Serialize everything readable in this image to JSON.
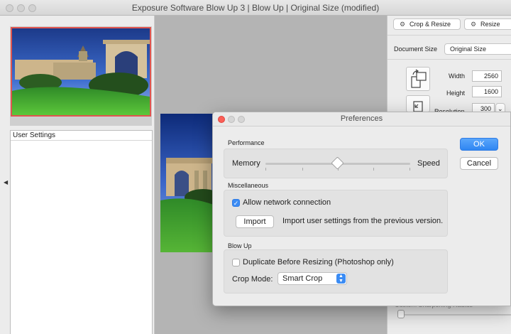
{
  "window": {
    "title": "Exposure Software Blow Up 3 | Blow Up | Original Size (modified)"
  },
  "left_panel": {
    "user_settings_header": "User Settings"
  },
  "right_panel": {
    "tabs": [
      "Crop & Resize",
      "Resize"
    ],
    "document_size_label": "Document Size",
    "document_size_value": "Original Size",
    "width_label": "Width",
    "width_value": "2560",
    "height_label": "Height",
    "height_value": "1600",
    "resolution_label": "Resolution",
    "resolution_value": "300",
    "sharpening_label": "Custom Sharpening Radius"
  },
  "dialog": {
    "title": "Preferences",
    "ok_label": "OK",
    "cancel_label": "Cancel",
    "performance": {
      "section_label": "Performance",
      "memory_label": "Memory",
      "speed_label": "Speed",
      "slider_value_fraction": 0.5
    },
    "miscellaneous": {
      "section_label": "Miscellaneous",
      "allow_network_label": "Allow network connection",
      "allow_network_checked": true,
      "import_button": "Import",
      "import_description": "Import user settings from the previous version."
    },
    "blow_up": {
      "section_label": "Blow Up",
      "duplicate_label": "Duplicate Before Resizing (Photoshop only)",
      "duplicate_checked": false,
      "crop_mode_label": "Crop Mode:",
      "crop_mode_value": "Smart Crop"
    }
  },
  "colors": {
    "accent": "#3b8cf4",
    "selection_border": "#e0554f"
  },
  "icons": [
    "swap-orientation-icon",
    "crop-icon",
    "gear-icon",
    "chevron-updown-icon",
    "left-arrow-icon"
  ]
}
